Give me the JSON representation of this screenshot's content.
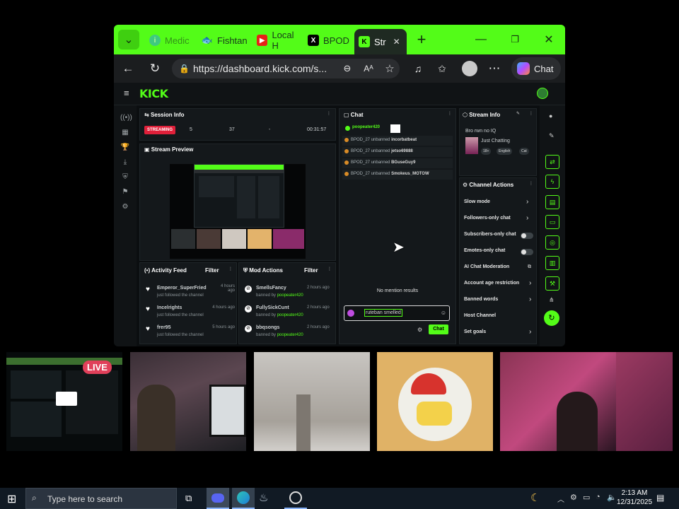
{
  "browser": {
    "tabs": [
      {
        "label": "Medic",
        "icon": "info-icon",
        "active": false
      },
      {
        "label": "Fishtan",
        "icon": "fish-icon",
        "active": false
      },
      {
        "label": "Local H",
        "icon": "youtube-icon",
        "active": false
      },
      {
        "label": "BPOD",
        "icon": "x-icon",
        "active": false
      },
      {
        "label": "Str",
        "icon": "kick-icon",
        "active": true
      }
    ],
    "url": "https://dashboard.kick.com/s...",
    "copilot_label": "Chat"
  },
  "kick": {
    "logo": "KICK",
    "session_info": {
      "title": "Session Info",
      "status": "STREAMING",
      "stat1": "5",
      "stat2": "37",
      "stat3": "-",
      "duration": "00:31:57"
    },
    "stream_preview": {
      "title": "Stream Preview"
    },
    "activity_feed": {
      "title": "Activity Feed",
      "filter": "Filter",
      "items": [
        {
          "name": "Emperor_SuperFried",
          "sub": "just followed the channel",
          "time": "4 hours ago"
        },
        {
          "name": "Incelrights",
          "sub": "just followed the channel",
          "time": "4 hours ago"
        },
        {
          "name": "frer95",
          "sub": "just followed the channel",
          "time": "5 hours ago"
        }
      ]
    },
    "mod_actions": {
      "title": "Mod Actions",
      "filter": "Filter",
      "items": [
        {
          "name": "SmellsFancy",
          "sub": "banned by",
          "by": "poopeater420",
          "time": "2 hours ago"
        },
        {
          "name": "FullySickCunt",
          "sub": "banned by",
          "by": "poopeater420",
          "time": "2 hours ago"
        },
        {
          "name": "bbqsongs",
          "sub": "banned by",
          "by": "poopeater420",
          "time": "2 hours ago"
        }
      ]
    },
    "chat": {
      "title": "Chat",
      "mention_user": "poopeater420",
      "messages": [
        {
          "user": "BPOD_27",
          "action": "unbanned",
          "target": "incorbatbeat"
        },
        {
          "user": "BPOD_27",
          "action": "unbanned",
          "target": "jetso69888"
        },
        {
          "user": "BPOD_27",
          "action": "unbanned",
          "target": "BGuseGuy9"
        },
        {
          "user": "BPOD_27",
          "action": "unbanned",
          "target": "Smokeus_MOTOW"
        }
      ],
      "empty_text": "No mention results",
      "input_value": "ruteban smelled",
      "send_label": "Chat"
    },
    "stream_info": {
      "title": "Stream Info",
      "stream_title": "Bro rwn no IQ",
      "category": "Just Chatting",
      "tags": [
        "18+",
        "English",
        "Cat"
      ]
    },
    "channel_actions": {
      "title": "Channel Actions",
      "items": [
        {
          "label": "Slow mode",
          "control": "chevron"
        },
        {
          "label": "Followers-only chat",
          "control": "chevron"
        },
        {
          "label": "Subscribers-only chat",
          "control": "toggle"
        },
        {
          "label": "Emotes-only chat",
          "control": "toggle"
        },
        {
          "label": "AI Chat Moderation",
          "control": "external"
        },
        {
          "label": "Account age restriction",
          "control": "chevron"
        },
        {
          "label": "Banned words",
          "control": "chevron"
        },
        {
          "label": "Host Channel",
          "control": "none"
        },
        {
          "label": "Set goals",
          "control": "chevron"
        }
      ]
    }
  },
  "overlay": {
    "live_label": "LIVE"
  },
  "taskbar": {
    "search_placeholder": "Type here to search",
    "time": "2:13 AM",
    "date": "12/31/2025"
  },
  "colors": {
    "kick_green": "#53fc18",
    "live_red": "#e0405a",
    "taskbar": "#111a24"
  }
}
